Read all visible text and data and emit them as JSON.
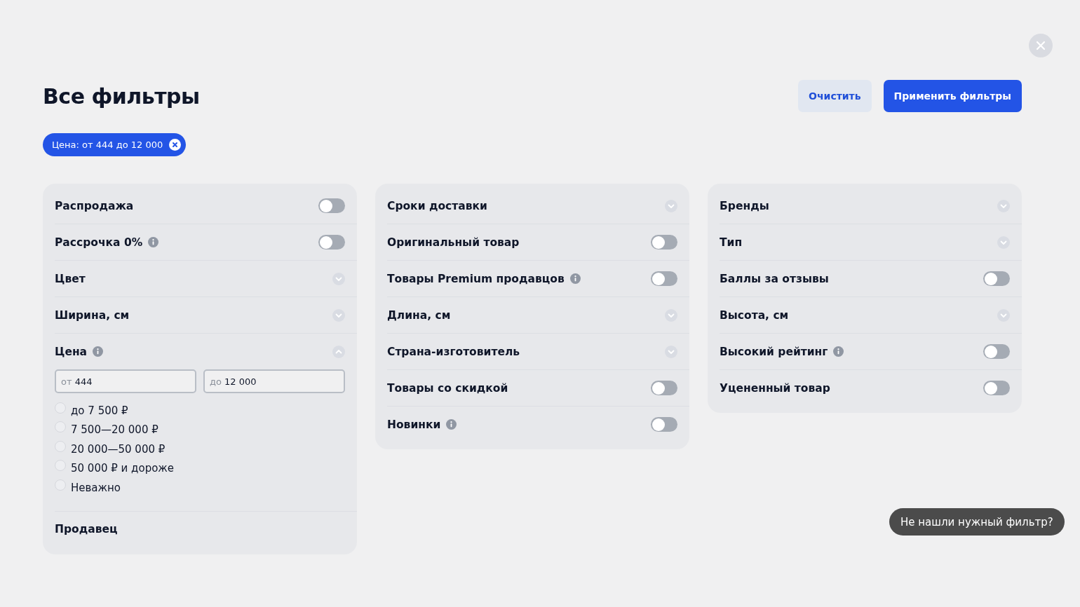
{
  "title": "Все фильтры",
  "actions": [
    {
      "label": "Очистить",
      "kind": "secondary"
    },
    {
      "label": "Применить фильтры",
      "kind": "primary"
    }
  ],
  "active_filters": [
    {
      "label": "Цена: от 444 до 12 000"
    }
  ],
  "columns": [
    {
      "rows": [
        {
          "label": "Распродажа",
          "kind": "toggle",
          "on": false,
          "info": false
        },
        {
          "label": "Рассрочка 0%",
          "kind": "toggle",
          "on": false,
          "info": true
        },
        {
          "label": "Цвет",
          "kind": "dropdown",
          "expanded": false,
          "info": false
        },
        {
          "label": "Ширина, см",
          "kind": "dropdown",
          "expanded": false,
          "info": false
        },
        {
          "label": "Цена",
          "kind": "dropdown",
          "expanded": true,
          "info": true,
          "range": {
            "from": {
              "prefix": "от",
              "value": "444"
            },
            "to": {
              "prefix": "до",
              "value": "12 000"
            }
          },
          "options": [
            {
              "label": "до 7 500 ₽",
              "selected": false
            },
            {
              "label": "7 500—20 000 ₽",
              "selected": false
            },
            {
              "label": "20 000—50 000 ₽",
              "selected": false
            },
            {
              "label": "50 000 ₽ и дороже",
              "selected": false
            },
            {
              "label": "Неважно",
              "selected": false
            }
          ]
        },
        {
          "label": "Продавец",
          "kind": "plain",
          "info": false
        }
      ]
    },
    {
      "rows": [
        {
          "label": "Сроки доставки",
          "kind": "dropdown",
          "expanded": false,
          "info": false
        },
        {
          "label": "Оригинальный товар",
          "kind": "toggle",
          "on": false,
          "info": false
        },
        {
          "label": "Товары Premium продавцов",
          "kind": "toggle",
          "on": false,
          "info": true
        },
        {
          "label": "Длина, см",
          "kind": "dropdown",
          "expanded": false,
          "info": false
        },
        {
          "label": "Страна-изготовитель",
          "kind": "dropdown",
          "expanded": false,
          "info": false
        },
        {
          "label": "Товары со скидкой",
          "kind": "toggle",
          "on": false,
          "info": false
        },
        {
          "label": "Новинки",
          "kind": "toggle",
          "on": false,
          "info": true
        }
      ]
    },
    {
      "rows": [
        {
          "label": "Бренды",
          "kind": "dropdown",
          "expanded": false,
          "info": false
        },
        {
          "label": "Тип",
          "kind": "dropdown",
          "expanded": false,
          "info": false
        },
        {
          "label": "Баллы за отзывы",
          "kind": "toggle",
          "on": false,
          "info": false
        },
        {
          "label": "Высота, см",
          "kind": "dropdown",
          "expanded": false,
          "info": false
        },
        {
          "label": "Высокий рейтинг",
          "kind": "toggle",
          "on": false,
          "info": true
        },
        {
          "label": "Уцененный товар",
          "kind": "toggle",
          "on": false,
          "info": false
        }
      ]
    }
  ],
  "help_tooltip": "Не нашли нужный фильтр?"
}
